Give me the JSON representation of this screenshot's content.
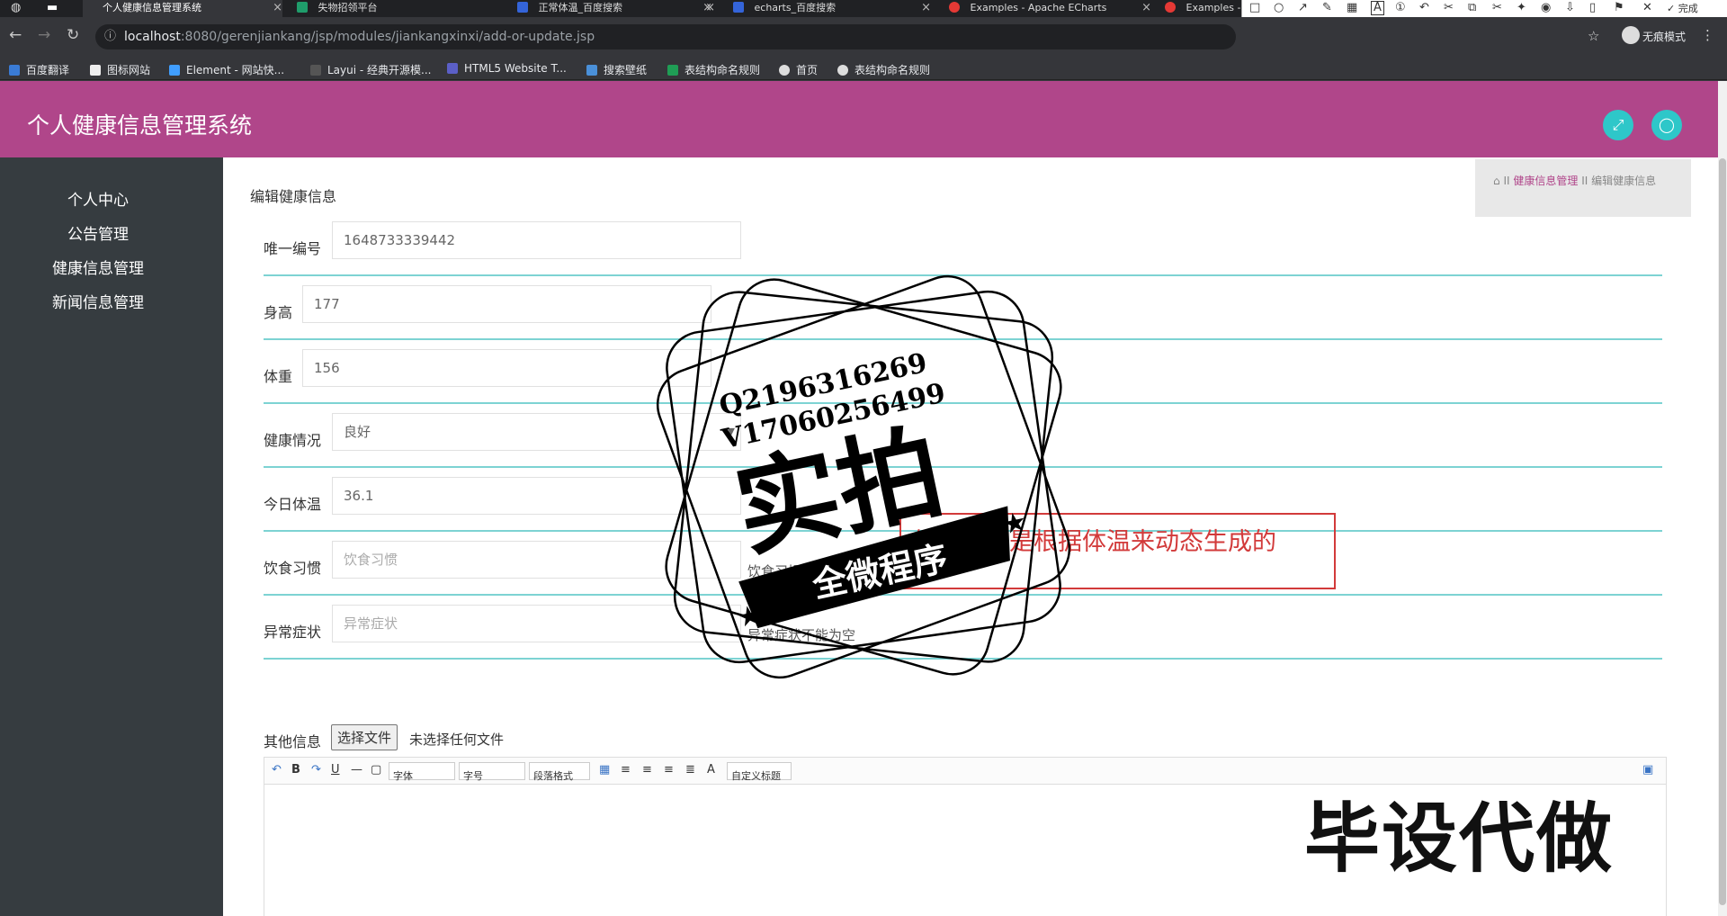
{
  "browser": {
    "tabs": [
      {
        "title": "个人健康信息管理系统",
        "active": true
      },
      {
        "title": "失物招领平台"
      },
      {
        "title": "正常体温_百度搜索"
      },
      {
        "title": "echarts_百度搜索"
      },
      {
        "title": "Examples - Apache ECharts"
      },
      {
        "title": "Examples -"
      }
    ],
    "url_host": "localhost",
    "url_rest": ":8080/gerenjiankang/jsp/modules/jiankangxinxi/add-or-update.jsp",
    "incognito_label": "无痕模式",
    "bookmarks": [
      "百度翻译",
      "图标网站",
      "Element - 网站快...",
      "Layui - 经典开源模...",
      "HTML5 Website T...",
      "搜索壁纸",
      "表结构命名规则",
      "首页",
      "表结构命名规则"
    ],
    "annotation": {
      "font_size": "20",
      "active_color": "#e53935"
    }
  },
  "app": {
    "title": "个人健康信息管理系统",
    "brand_color": "#b0468a",
    "accent_color": "#2ec7c9",
    "fullscreen_icon": "expand-icon",
    "user_icon": "user-icon"
  },
  "sidebar": {
    "items": [
      {
        "label": "个人中心"
      },
      {
        "label": "公告管理"
      },
      {
        "label": "健康信息管理"
      },
      {
        "label": "新闻信息管理"
      }
    ]
  },
  "main": {
    "title": "编辑健康信息",
    "breadcrumb": {
      "home_icon": "home-icon",
      "sep": "II",
      "section": "健康信息管理",
      "current": "编辑健康信息"
    }
  },
  "form": {
    "id": {
      "label": "唯一编号",
      "value": "1648733339442"
    },
    "height": {
      "label": "身高",
      "value": "177"
    },
    "weight": {
      "label": "体重",
      "value": "156"
    },
    "health": {
      "label": "健康情况",
      "value": "良好"
    },
    "temperature": {
      "label": "今日体温",
      "value": "36.1"
    },
    "diet": {
      "label": "饮食习惯",
      "placeholder": "饮食习惯",
      "hint": "饮食习惯"
    },
    "symptom": {
      "label": "异常症状",
      "placeholder": "异常症状",
      "hint": "异常症状不能为空"
    },
    "other": {
      "label": "其他信息",
      "file_button": "选择文件",
      "file_status": "未选择任何文件"
    },
    "editor_toolbar": {
      "font_family": "字体",
      "font_size": "字号",
      "paragraph": "段落格式",
      "custom_title": "自定义标题",
      "bold": "B",
      "underline": "U",
      "font_color": "A"
    }
  },
  "watermark": {
    "contact_q": "Q2196316269",
    "contact_v": "V17060256499",
    "main": "实拍",
    "banner": "全微程序",
    "note": "体温类型是根据体温来动态生成的",
    "corner": "毕设代做"
  }
}
